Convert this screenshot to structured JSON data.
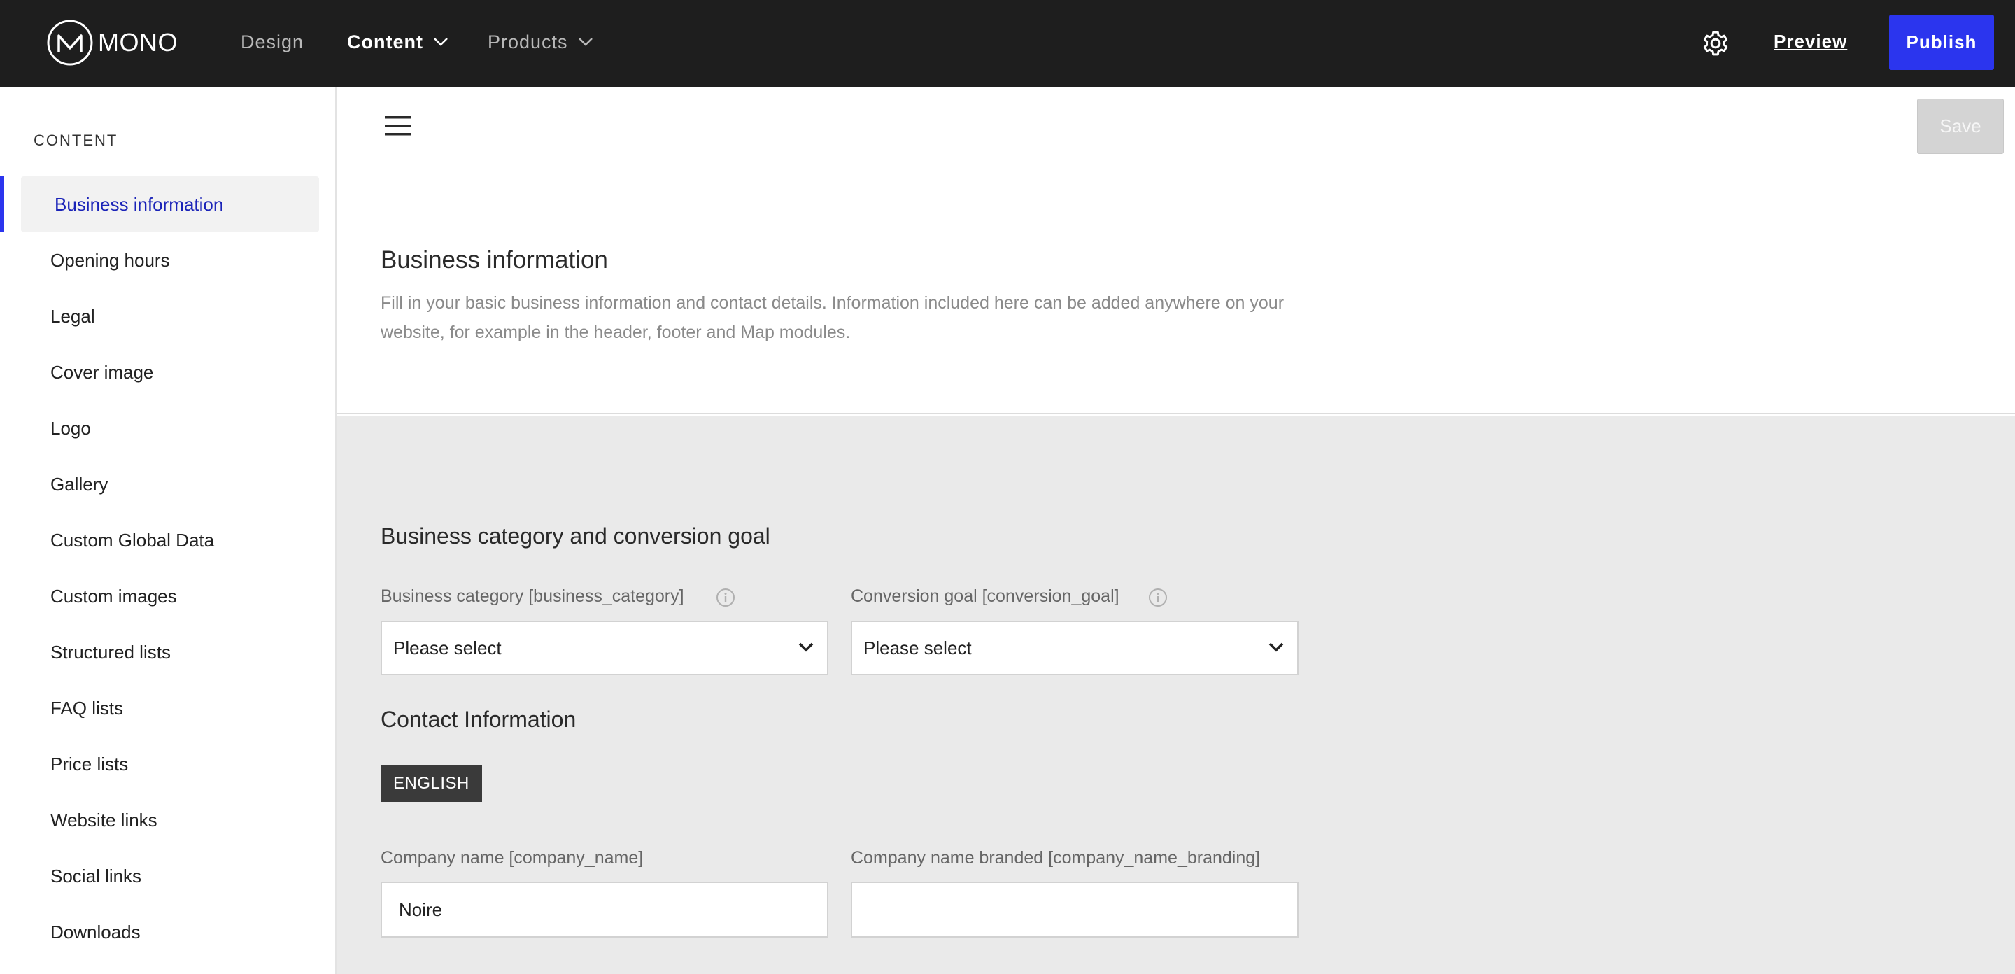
{
  "topbar": {
    "logo_text": "MONO",
    "nav": [
      {
        "label": "Design"
      },
      {
        "label": "Content"
      },
      {
        "label": "Products"
      }
    ],
    "preview_label": "Preview",
    "publish_label": "Publish",
    "colors": {
      "background": "#1e1e1e",
      "accent": "#2b35ee"
    }
  },
  "sidebar": {
    "heading": "CONTENT",
    "items": [
      {
        "label": "Business information"
      },
      {
        "label": "Opening hours"
      },
      {
        "label": "Legal"
      },
      {
        "label": "Cover image"
      },
      {
        "label": "Logo"
      },
      {
        "label": "Gallery"
      },
      {
        "label": "Custom Global Data"
      },
      {
        "label": "Custom images"
      },
      {
        "label": "Structured lists"
      },
      {
        "label": "FAQ lists"
      },
      {
        "label": "Price lists"
      },
      {
        "label": "Website links"
      },
      {
        "label": "Social links"
      },
      {
        "label": "Downloads"
      }
    ]
  },
  "page": {
    "save_label": "Save",
    "title": "Business information",
    "description": "Fill in your basic business information and contact details. Information included here can be added anywhere on your website, for example in the header, footer and Map modules."
  },
  "form": {
    "category_section_title": "Business category and conversion goal",
    "business_category_label": "Business category [business_category]",
    "business_category_value": "Please select",
    "conversion_goal_label": "Conversion goal [conversion_goal]",
    "conversion_goal_value": "Please select",
    "contact_section_title": "Contact Information",
    "language_badge": "ENGLISH",
    "company_name_label": "Company name [company_name]",
    "company_name_value": "Noire",
    "company_name_branded_label": "Company name branded [company_name_branding]",
    "company_name_branded_value": ""
  }
}
